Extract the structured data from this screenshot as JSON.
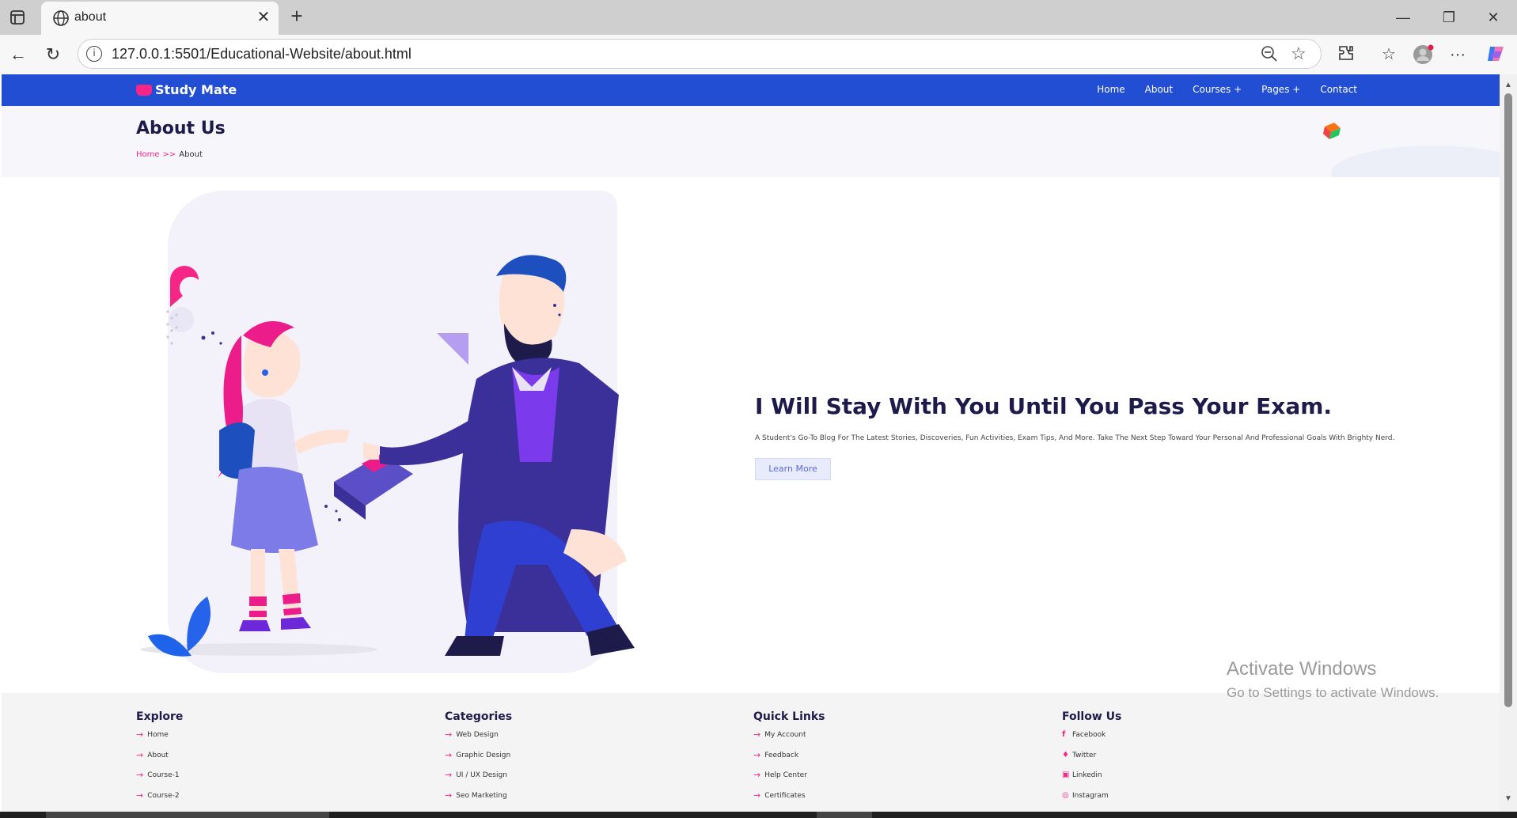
{
  "browser": {
    "tab_title": "about",
    "url": "127.0.0.1:5501/Educational-Website/about.html"
  },
  "site": {
    "logo_text": "Study Mate",
    "nav": [
      "Home",
      "About",
      "Courses +",
      "Pages +",
      "Contact"
    ]
  },
  "banner": {
    "title": "About Us",
    "breadcrumb_home": "Home",
    "breadcrumb_sep": ">>",
    "breadcrumb_current": "About"
  },
  "about": {
    "heading": "I Will Stay With You Until You Pass Your Exam.",
    "description": "A Student's Go-To Blog For The Latest Stories, Discoveries, Fun Activities, Exam Tips, And More. Take The Next Step Toward Your Personal And Professional Goals With Brighty Nerd.",
    "button": "Learn More"
  },
  "footer": {
    "columns": [
      {
        "title": "Explore",
        "items": [
          "Home",
          "About",
          "Course-1",
          "Course-2"
        ]
      },
      {
        "title": "Categories",
        "items": [
          "Web Design",
          "Graphic Design",
          "UI / UX Design",
          "Seo Marketing"
        ]
      },
      {
        "title": "Quick Links",
        "items": [
          "My Account",
          "Feedback",
          "Help Center",
          "Certificates"
        ]
      },
      {
        "title": "Follow Us",
        "items": [
          "Facebook",
          "Twitter",
          "Linkedin",
          "Instagram"
        ]
      }
    ]
  },
  "watermark": {
    "title": "Activate Windows",
    "subtitle": "Go to Settings to activate Windows."
  },
  "colors": {
    "nav_blue": "#214ed3",
    "accent_pink": "#f72585",
    "heading_navy": "#1e1b4b"
  }
}
